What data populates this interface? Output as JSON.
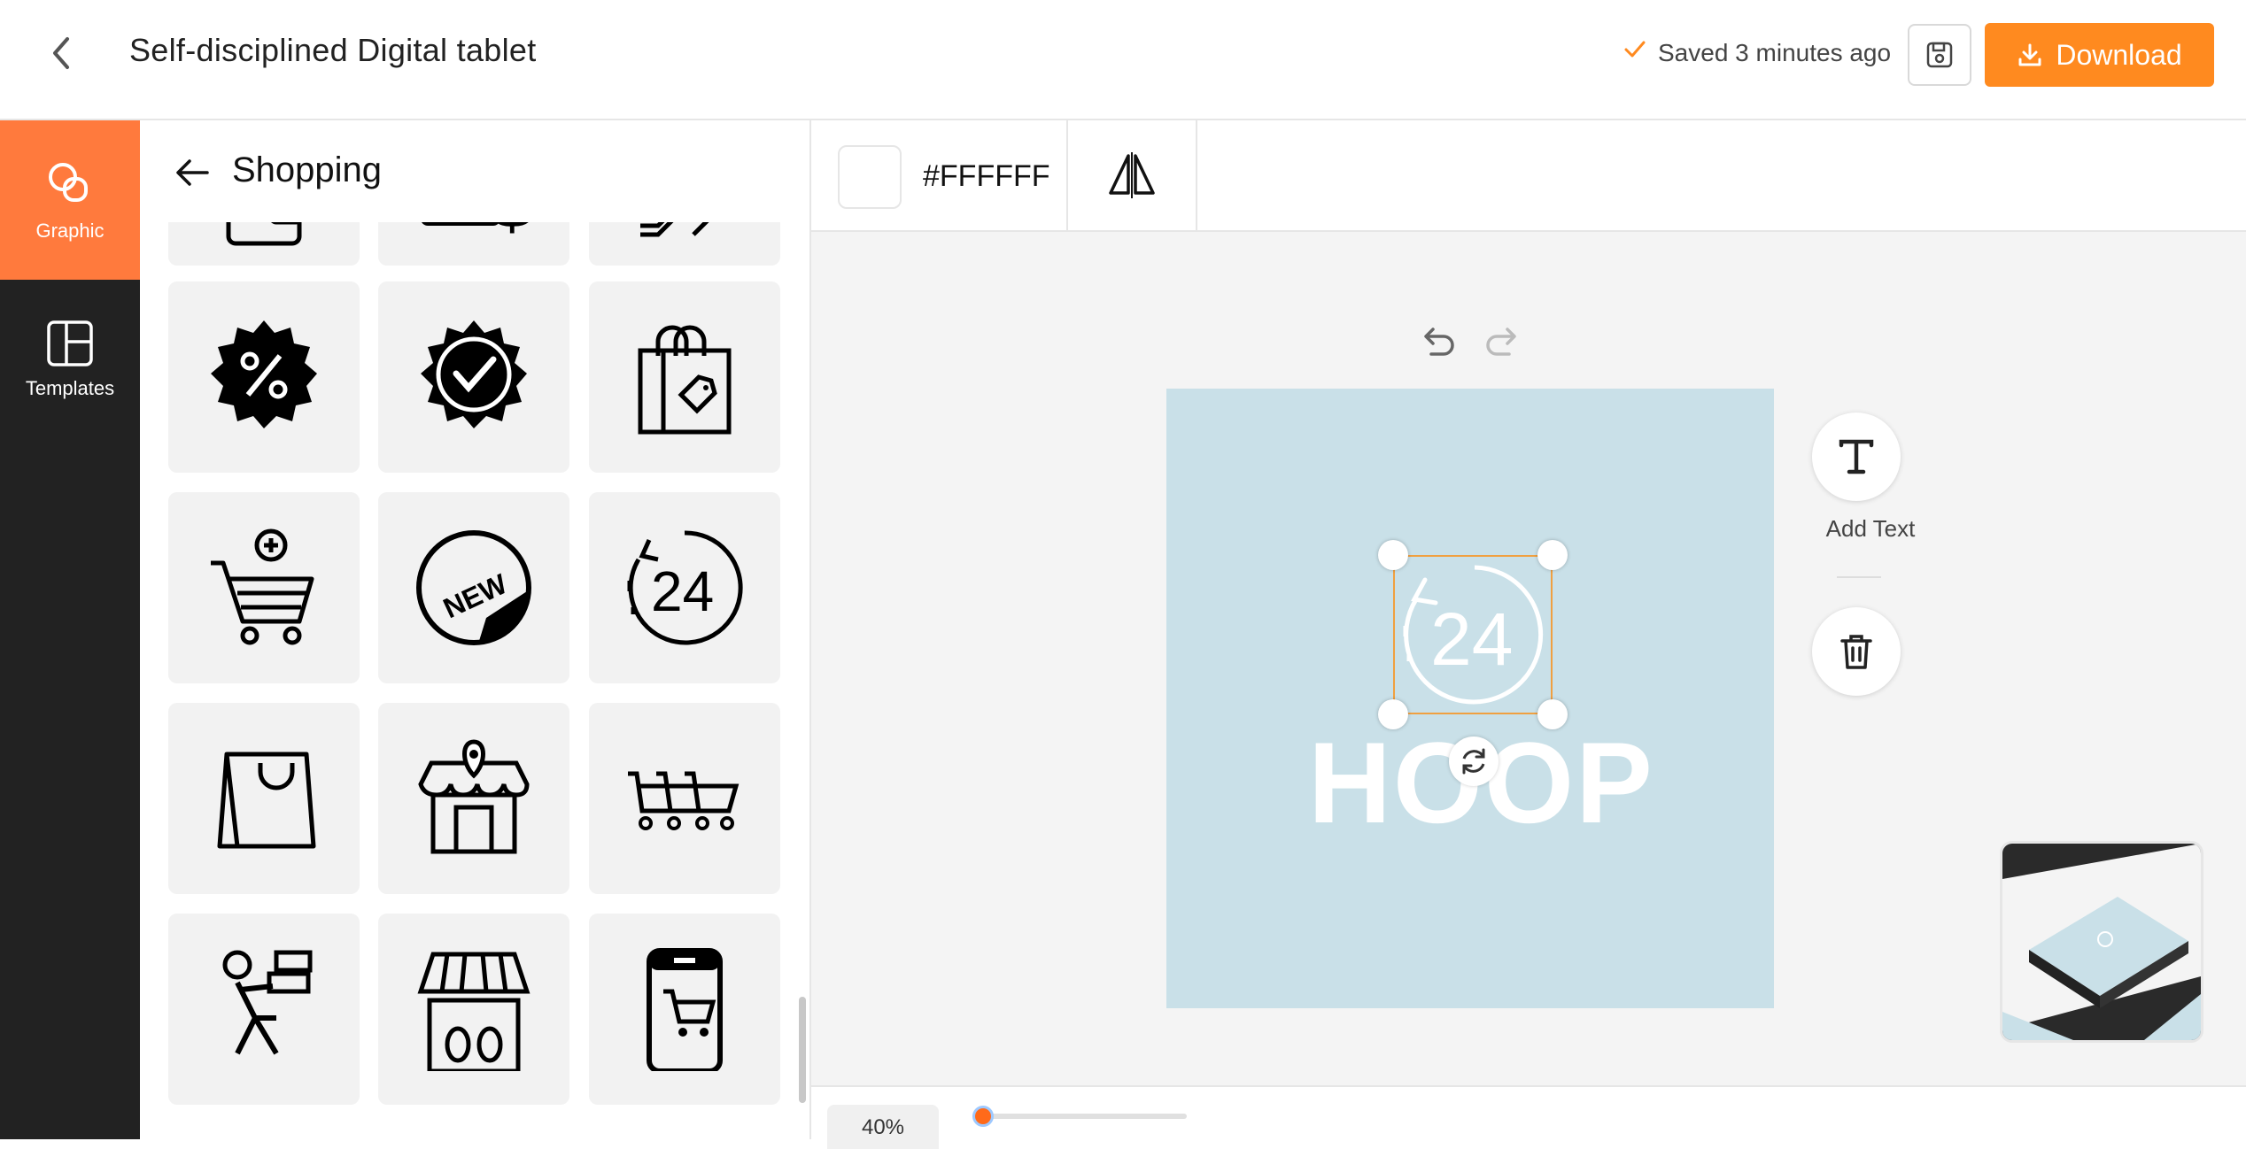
{
  "header": {
    "title": "Self-disciplined Digital tablet",
    "saved_status": "Saved 3 minutes ago",
    "download_label": "Download"
  },
  "leftnav": {
    "items": [
      {
        "label": "Graphic",
        "active": true
      },
      {
        "label": "Templates",
        "active": false
      }
    ]
  },
  "panel": {
    "title": "Shopping",
    "icons": [
      "wallet-icon",
      "credit-card-dollar-icon",
      "escalator-icon",
      "discount-badge-icon",
      "verified-badge-icon",
      "shopping-bag-tag-icon",
      "add-to-cart-icon",
      "new-sticker-icon",
      "24-hours-icon",
      "shopping-bag-icon",
      "store-location-icon",
      "shopping-carts-icon",
      "delivery-man-icon",
      "market-stall-icon",
      "mobile-shopping-icon"
    ]
  },
  "toolbar": {
    "color_hex": "#FFFFFF",
    "flip_icon": "flip-horizontal-icon"
  },
  "canvas": {
    "background": "#c9e0e8",
    "logo_number": "24",
    "brand_text": "HOOP"
  },
  "side_actions": {
    "add_text_label": "Add Text",
    "add_text_icon": "T"
  },
  "zoom": {
    "value": "40%",
    "level": 0.05
  },
  "colors": {
    "accent": "#ff8a1f",
    "nav_active": "#ff7a3d",
    "nav_bg": "#222222"
  }
}
